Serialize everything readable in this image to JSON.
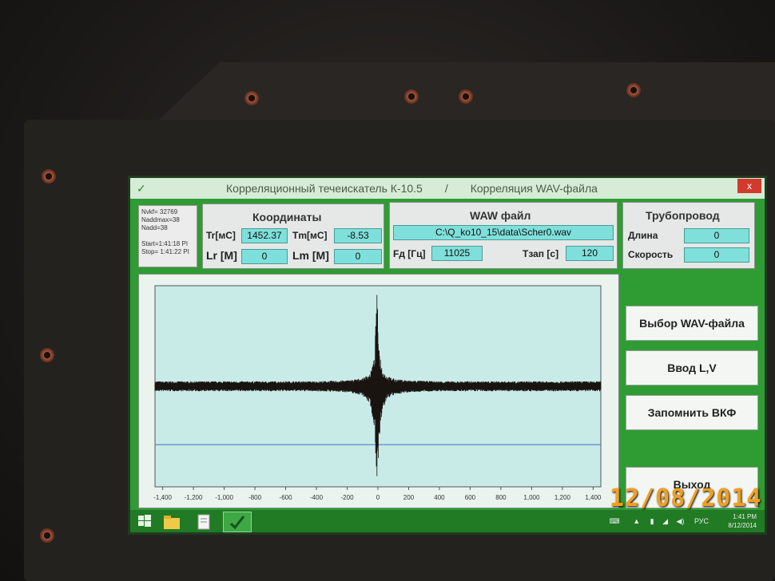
{
  "window": {
    "title_left": "Корреляционный течеискатель К-10.5",
    "title_sep": "/",
    "title_right": "Корреляция WAV-файла",
    "close": "x"
  },
  "info": {
    "line1": "Nvkf= 32769",
    "line2": "Naddmax=38",
    "line3": "Nadd=38",
    "line4": "Start=1:41:18 PI",
    "line5": "Stop= 1:41:22 PI"
  },
  "coords": {
    "title": "Координаты",
    "tr_label": "Tr[мС]",
    "tr_value": "1452.37",
    "tm_label": "Tm[мС]",
    "tm_value": "-8.53",
    "lr_label": "Lr [M]",
    "lr_value": "0",
    "lm_label": "Lm [M]",
    "lm_value": "0"
  },
  "wav": {
    "title": "WAW файл",
    "path": "C:\\Q_ko10_15\\data\\Scher0.wav",
    "fd_label": "Fд [Гц]",
    "fd_value": "11025",
    "tzap_label": "Тзап [с]",
    "tzap_value": "120"
  },
  "pipe": {
    "title": "Трубопровод",
    "length_label": "Длина",
    "length_value": "0",
    "speed_label": "Скорость",
    "speed_value": "0"
  },
  "buttons": {
    "select_wav": "Выбор WAV-файла",
    "enter_lv": "Ввод L,V",
    "remember": "Запомнить ВКФ",
    "exit": "Выход"
  },
  "chart_data": {
    "type": "line",
    "x_ticks": [
      "-1,400",
      "-1,200",
      "-1,000",
      "-800",
      "-600",
      "-400",
      "-200",
      "0",
      "200",
      "400",
      "600",
      "800",
      "1,000",
      "1,200",
      "1,400"
    ],
    "xlim": [
      -1450,
      1450
    ],
    "ylim": [
      -1,
      1
    ],
    "series": [
      {
        "x": [
          -1450,
          -1200,
          -1000,
          -800,
          -600,
          -400,
          -200,
          -100,
          -50,
          -20,
          -8.5,
          10,
          30,
          60,
          120,
          200,
          400,
          600,
          800,
          1000,
          1200,
          1450
        ],
        "y_max": [
          0.05,
          0.05,
          0.05,
          0.05,
          0.05,
          0.05,
          0.06,
          0.08,
          0.13,
          0.3,
          1.0,
          0.35,
          0.16,
          0.1,
          0.07,
          0.06,
          0.05,
          0.05,
          0.05,
          0.05,
          0.05,
          0.05
        ],
        "y_min": [
          -0.05,
          -0.05,
          -0.05,
          -0.05,
          -0.05,
          -0.05,
          -0.06,
          -0.09,
          -0.18,
          -0.45,
          -0.95,
          -0.55,
          -0.25,
          -0.12,
          -0.08,
          -0.06,
          -0.05,
          -0.05,
          -0.05,
          -0.05,
          -0.05,
          -0.05
        ]
      }
    ],
    "colors": {
      "plot_bg": "#c8ebe8",
      "signal": "#1a1410",
      "baseline": "#4a6fb8"
    }
  },
  "taskbar": {
    "lang": "РУС",
    "time": "1:41 PM",
    "date": "8/12/2014"
  },
  "photo_datestamp": "12/08/2014"
}
